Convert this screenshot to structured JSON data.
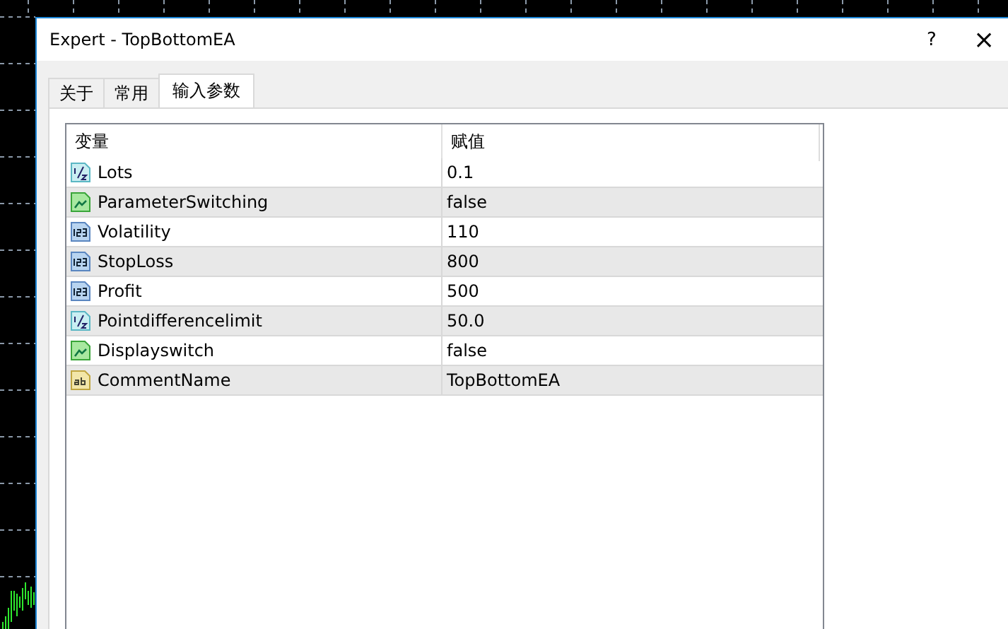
{
  "window": {
    "title": "Expert - TopBottomEA",
    "help": "?",
    "close": "×"
  },
  "tabs": [
    {
      "label": "关于",
      "selected": false
    },
    {
      "label": "常用",
      "selected": false
    },
    {
      "label": "输入参数",
      "selected": true
    }
  ],
  "table": {
    "columns": [
      "变量",
      "赋值"
    ],
    "rows": [
      {
        "kind": "double",
        "name": "Lots",
        "value": "0.1"
      },
      {
        "kind": "bool",
        "name": "ParameterSwitching",
        "value": "false"
      },
      {
        "kind": "int",
        "name": "Volatility",
        "value": "110"
      },
      {
        "kind": "int",
        "name": "StopLoss",
        "value": "800"
      },
      {
        "kind": "int",
        "name": "Profit",
        "value": "500"
      },
      {
        "kind": "double",
        "name": "Pointdifferencelimit",
        "value": "50.0"
      },
      {
        "kind": "bool",
        "name": "Displayswitch",
        "value": "false"
      },
      {
        "kind": "string",
        "name": "CommentName",
        "value": "TopBottomEA"
      }
    ]
  }
}
